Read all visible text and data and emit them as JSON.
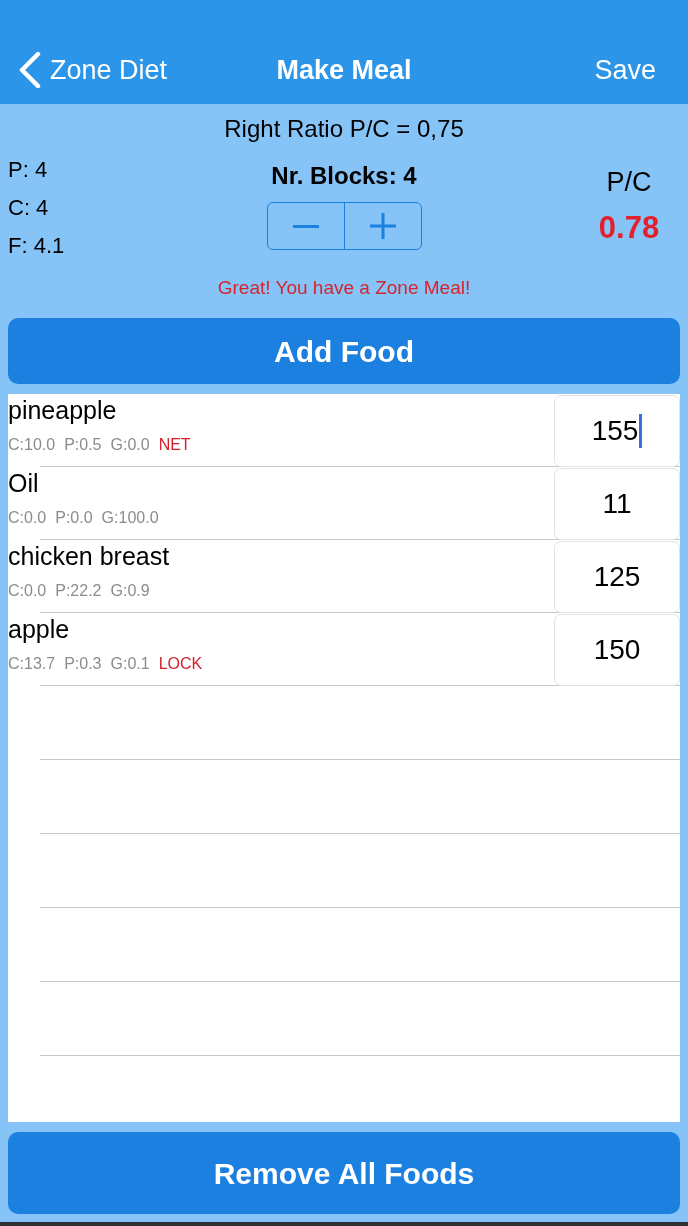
{
  "nav": {
    "back_label": "Zone Diet",
    "title": "Make Meal",
    "action": "Save"
  },
  "summary": {
    "target_ratio": "Right Ratio P/C = 0,75",
    "macros": [
      "P: 4",
      "C: 4",
      "F: 4.1"
    ],
    "blocks_label": "Nr. Blocks: 4",
    "ratio_label": "P/C",
    "ratio_value": "0.78",
    "message": "Great! You have a Zone Meal!"
  },
  "add_button": "Add Food",
  "foods": [
    {
      "name": "pineapple",
      "nutrients": [
        "C:10.0",
        "P:0.5",
        "G:0.0"
      ],
      "tag": "NET",
      "quantity": "155",
      "focused": true
    },
    {
      "name": "Oil",
      "nutrients": [
        "C:0.0",
        "P:0.0",
        "G:100.0"
      ],
      "quantity": "11",
      "focused": false
    },
    {
      "name": "chicken breast",
      "nutrients": [
        "C:0.0",
        "P:22.2",
        "G:0.9"
      ],
      "quantity": "125",
      "focused": false
    },
    {
      "name": "apple",
      "nutrients": [
        "C:13.7",
        "P:0.3",
        "G:0.1"
      ],
      "tag": "LOCK",
      "quantity": "150",
      "focused": false
    }
  ],
  "remove_button": "Remove All Foods"
}
